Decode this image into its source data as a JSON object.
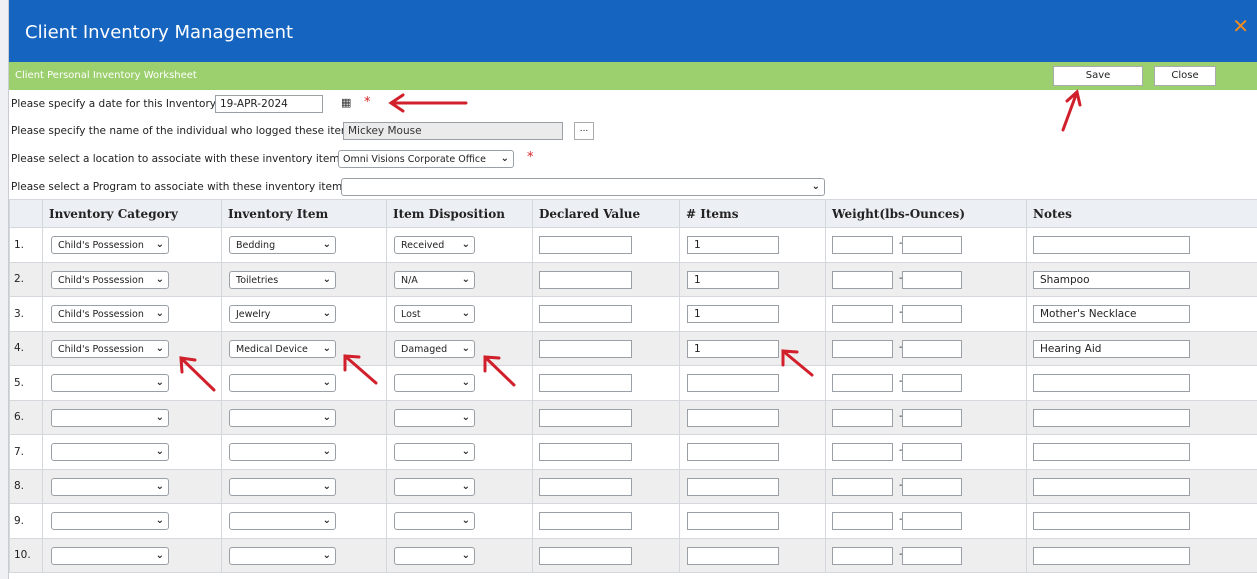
{
  "window": {
    "title": "Client Inventory Management",
    "close_icon": "close-icon"
  },
  "toolbar": {
    "subtitle": "Client Personal Inventory Worksheet",
    "save_label": "Save",
    "close_label": "Close"
  },
  "form": {
    "date_label": "Please specify a date for this Inventory:",
    "date_value": "19-APR-2024",
    "logged_by_label": "Please specify the name of the individual who logged these items:",
    "logged_by_value": "Mickey Mouse",
    "lookup_label": "...",
    "location_label": "Please select a location to associate with these inventory items:",
    "location_value": "Omni Visions Corporate Office",
    "program_label": "Please select a Program to associate with these inventory items:",
    "program_value": "",
    "required_mark": "*"
  },
  "grid": {
    "headers": [
      "",
      "Inventory Category",
      "Inventory Item",
      "Item Disposition",
      "Declared Value",
      "# Items",
      "Weight(lbs-Ounces)",
      "Notes"
    ],
    "rows": [
      {
        "num": "1.",
        "category": "Child's Possession",
        "item": "Bedding",
        "disposition": "Received",
        "value": "",
        "count": "1",
        "notes": ""
      },
      {
        "num": "2.",
        "category": "Child's Possession",
        "item": "Toiletries",
        "disposition": "N/A",
        "value": "",
        "count": "1",
        "notes": "Shampoo"
      },
      {
        "num": "3.",
        "category": "Child's Possession",
        "item": "Jewelry",
        "disposition": "Lost",
        "value": "",
        "count": "1",
        "notes": "Mother's Necklace"
      },
      {
        "num": "4.",
        "category": "Child's Possession",
        "item": "Medical Device",
        "disposition": "Damaged",
        "value": "",
        "count": "1",
        "notes": "Hearing Aid"
      },
      {
        "num": "5.",
        "category": "",
        "item": "",
        "disposition": "",
        "value": "",
        "count": "",
        "notes": ""
      },
      {
        "num": "6.",
        "category": "",
        "item": "",
        "disposition": "",
        "value": "",
        "count": "",
        "notes": ""
      },
      {
        "num": "7.",
        "category": "",
        "item": "",
        "disposition": "",
        "value": "",
        "count": "",
        "notes": ""
      },
      {
        "num": "8.",
        "category": "",
        "item": "",
        "disposition": "",
        "value": "",
        "count": "",
        "notes": ""
      },
      {
        "num": "9.",
        "category": "",
        "item": "",
        "disposition": "",
        "value": "",
        "count": "",
        "notes": ""
      },
      {
        "num": "10.",
        "category": "",
        "item": "",
        "disposition": "",
        "value": "",
        "count": "",
        "notes": ""
      }
    ]
  },
  "colors": {
    "title_bar": "#1565c0",
    "sub_bar": "#9ccf6d",
    "close_icon": "#f28b1e",
    "required": "#d32020",
    "annotation": "#d11f2b"
  },
  "icons": {
    "calendar": "calendar-icon",
    "dropdown": "chevron-down-icon"
  }
}
